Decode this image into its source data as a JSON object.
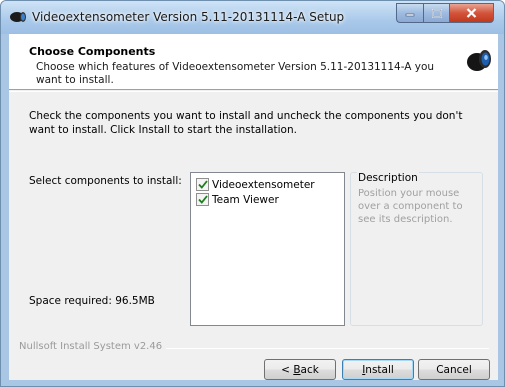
{
  "window": {
    "title": "Videoextensometer Version 5.11-20131114-A Setup",
    "icon": "camera-icon"
  },
  "header": {
    "title": "Choose Components",
    "subtitle": "Choose which features of Videoextensometer Version 5.11-20131114-A you want to install.",
    "icon": "camera-icon"
  },
  "body": {
    "intro": "Check the components you want to install and uncheck the components you don't want to install. Click Install to start the installation.",
    "select_label": "Select components to install:",
    "space_label": "Space required: 96.5MB",
    "components": [
      {
        "label": "Videoextensometer",
        "checked": true
      },
      {
        "label": "Team Viewer",
        "checked": true
      }
    ],
    "description": {
      "title": "Description",
      "text": "Position your mouse over a component to see its description."
    }
  },
  "footer": {
    "branding": "Nullsoft Install System v2.46",
    "back_prefix": "< ",
    "back_hotkey": "B",
    "back_rest": "ack",
    "install_hotkey": "I",
    "install_rest": "nstall",
    "cancel_label": "Cancel"
  },
  "colors": {
    "titlebar": "#a9c9ea",
    "close": "#c2381c",
    "check": "#1e7d1e"
  }
}
